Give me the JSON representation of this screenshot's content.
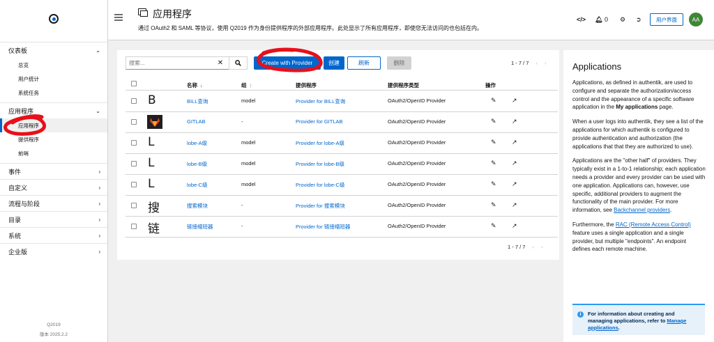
{
  "sidebar": {
    "groups": [
      {
        "label": "仪表板",
        "items": [
          "总览",
          "用户统计",
          "系统任务"
        ]
      },
      {
        "label": "应用程序",
        "items": [
          "应用程序",
          "提供程序",
          "前哨"
        ]
      },
      {
        "label": "事件"
      },
      {
        "label": "自定义"
      },
      {
        "label": "流程与阶段"
      },
      {
        "label": "目录"
      },
      {
        "label": "系统"
      },
      {
        "label": "企业版"
      }
    ],
    "active_item": "应用程序",
    "footer_brand": "Q2019",
    "footer_version": "版本 2025.2.2"
  },
  "header": {
    "title": "应用程序",
    "description": "通过 OAuth2 和 SAML 等协议，使用 Q2019 作为身份提供程序的外部应用程序。此处显示了所有应用程序，即使您无法访问的也包括在内。",
    "notification_count": "0",
    "user_interface_label": "用户界面",
    "avatar_initials": "AA"
  },
  "toolbar": {
    "search_placeholder": "搜索...",
    "create_with_provider": "Create with Provider",
    "create": "创建",
    "refresh": "刷新",
    "delete": "删除",
    "pagination": "1 - 7 / 7"
  },
  "table": {
    "headers": {
      "name": "名称",
      "group": "组",
      "provider": "提供程序",
      "provider_type": "提供程序类型",
      "actions": "操作"
    },
    "rows": [
      {
        "icon": "B",
        "name": "BILL查询",
        "group": "model",
        "provider": "Provider for BILL查询",
        "type": "OAuth2/OpenID Provider"
      },
      {
        "icon": "gitlab",
        "name": "GITLAB",
        "group": "-",
        "provider": "Provider for GITLAB",
        "type": "OAuth2/OpenID Provider"
      },
      {
        "icon": "L",
        "name": "lobe-A级",
        "group": "model",
        "provider": "Provider for lobe-A级",
        "type": "OAuth2/OpenID Provider"
      },
      {
        "icon": "L",
        "name": "lobe-B级",
        "group": "model",
        "provider": "Provider for lobe-B级",
        "type": "OAuth2/OpenID Provider"
      },
      {
        "icon": "L",
        "name": "lobe-C级",
        "group": "model",
        "provider": "Provider for lobe-C级",
        "type": "OAuth2/OpenID Provider"
      },
      {
        "icon": "搜",
        "name": "搜索模块",
        "group": "-",
        "provider": "Provider for 搜索模块",
        "type": "OAuth2/OpenID Provider"
      },
      {
        "icon": "链",
        "name": "链接缩短器",
        "group": "-",
        "provider": "Provider for 链接缩短器",
        "type": "OAuth2/OpenID Provider"
      }
    ]
  },
  "help_panel": {
    "title": "Applications",
    "p1_pre": "Applications, as defined in authentik, are used to configure and separate the authorization/access control and the appearance of a specific software application in the ",
    "p1_bold": "My applications",
    "p1_post": " page.",
    "p2": "When a user logs into authentik, they see a list of the applications for which authentik is configured to provide authentication and authorization (the applications that that they are authorized to use).",
    "p3_pre": "Applications are the \"other half\" of providers. They typically exist in a 1-to-1 relationship; each application needs a provider and every provider can be used with one application. Applications can, however, use specific, additional providers to augment the functionality of the main provider. For more information, see ",
    "p3_link": "Backchannel providers",
    "p3_post": ".",
    "p4_pre": "Furthermore, the ",
    "p4_link": "RAC (Remote Access Control)",
    "p4_post": " feature uses a single application and a single provider, but multiple \"endpoints\". An endpoint defines each remote machine.",
    "alert_pre": "For information about creating and managing applications, refer to ",
    "alert_link": "Manage applications",
    "alert_post": "."
  },
  "colors": {
    "accent": "#0066cc",
    "avatar": "#3e8635",
    "annotation": "#e8101a"
  }
}
